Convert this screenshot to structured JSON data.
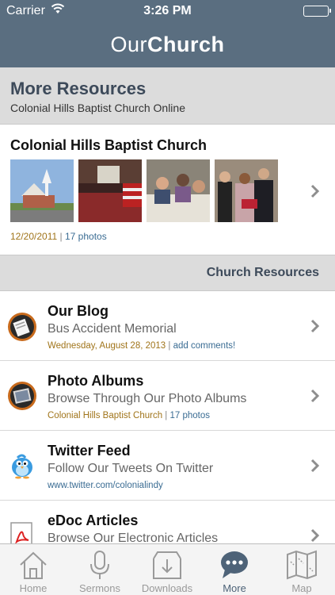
{
  "status_bar": {
    "carrier": "Carrier",
    "time": "3:26 PM"
  },
  "nav": {
    "brand_light": "Our",
    "brand_bold": "Church"
  },
  "header": {
    "title": "More Resources",
    "subtitle": "Colonial Hills Baptist Church Online"
  },
  "album": {
    "title": "Colonial Hills Baptist Church",
    "date": "12/20/2011",
    "separator": "|",
    "count": "17 photos"
  },
  "section": {
    "label": "Church Resources"
  },
  "items": [
    {
      "title": "Our Blog",
      "subtitle": "Bus Accident Memorial",
      "meta_gold": "Wednesday, August 28, 2013",
      "separator": "|",
      "meta_blue": "add comments!"
    },
    {
      "title": "Photo Albums",
      "subtitle": "Browse Through Our Photo Albums",
      "meta_gold": "Colonial Hills Baptist Church",
      "separator": "|",
      "meta_blue": "17 photos"
    },
    {
      "title": "Twitter Feed",
      "subtitle": "Follow Our Tweets On Twitter",
      "meta_blue": "www.twitter.com/colonialindy"
    },
    {
      "title": "eDoc Articles",
      "subtitle": "Browse Our Electronic Articles"
    }
  ],
  "tabs": [
    {
      "label": "Home",
      "icon": "home-icon"
    },
    {
      "label": "Sermons",
      "icon": "microphone-icon"
    },
    {
      "label": "Downloads",
      "icon": "download-icon"
    },
    {
      "label": "More",
      "icon": "more-icon",
      "active": true
    },
    {
      "label": "Map",
      "icon": "map-icon"
    }
  ],
  "colors": {
    "header_bg": "#5a6e80",
    "gray_bar": "#dcdcdc",
    "meta_gold": "#a0741a",
    "meta_blue": "#3a6c93",
    "tab_active": "#4e6378"
  }
}
